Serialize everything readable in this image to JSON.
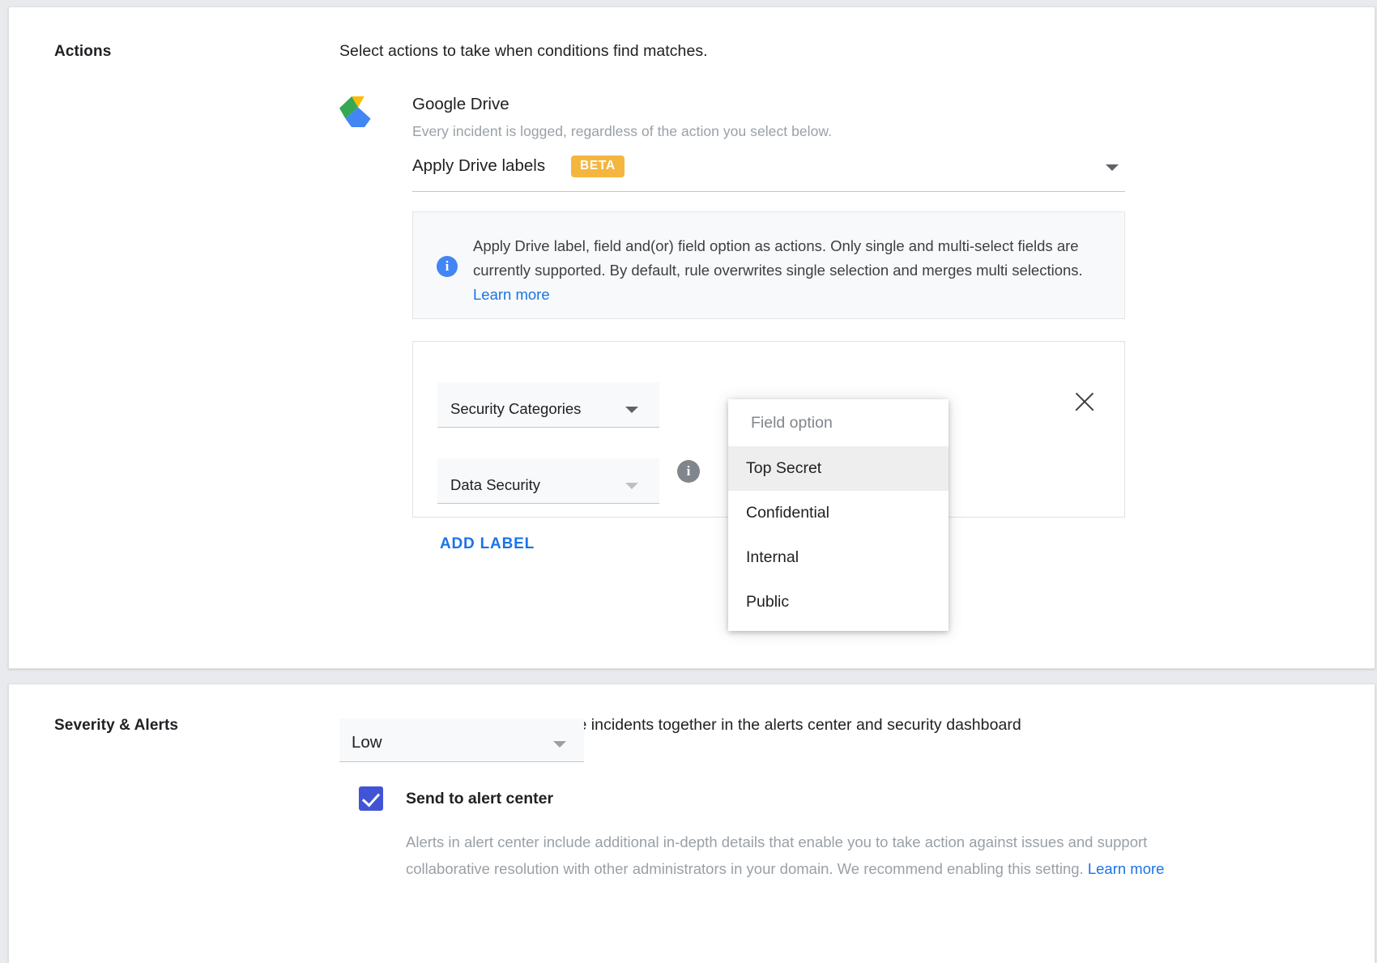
{
  "actions": {
    "section_label": "Actions",
    "description": "Select actions to take when conditions find matches.",
    "drive": {
      "icon": "google-drive-icon",
      "title": "Google Drive",
      "subtitle": "Every incident is logged, regardless of the action you select below.",
      "action_select": {
        "value": "Apply Drive labels",
        "badge": "BETA",
        "caret": "chevron-down-icon"
      }
    },
    "info_banner": {
      "icon": "info-icon",
      "text": "Apply Drive label, field and(or) field option as actions. Only single and multi-select fields are currently supported. By default, rule overwrites single selection and merges multi selections. ",
      "link": "Learn more"
    },
    "label_row": {
      "field_select": {
        "value": "Security Categories",
        "caret": "chevron-down-icon"
      },
      "option_select": {
        "value": "Data Security",
        "caret": "chevron-down-icon"
      },
      "row_info_icon": "info-icon",
      "remove_icon": "close-icon"
    },
    "add_label_button": "ADD LABEL",
    "field_option_menu": {
      "header": "Field option",
      "options": [
        "Top Secret",
        "Confidential",
        "Internal",
        "Public"
      ],
      "selected_index": 0
    }
  },
  "severity": {
    "section_label": "Severity & Alerts",
    "description": "Select a severity level to group rule incidents together in the alerts center and security dashboard",
    "level_select": {
      "value": "Low",
      "caret": "chevron-down-icon"
    },
    "alert_center": {
      "checked": true,
      "label": "Send to alert center",
      "help": "Alerts in alert center include additional in-depth details that enable you to take action against issues and support collaborative resolution with other administrators in your domain. We recommend enabling this setting. ",
      "help_link": "Learn more"
    }
  },
  "colors": {
    "accent_blue": "#1a73e8",
    "checkbox_blue": "#4154d6",
    "beta_amber": "#f4b63f",
    "info_blue": "#4285f4",
    "muted_text": "#9aa0a6"
  }
}
